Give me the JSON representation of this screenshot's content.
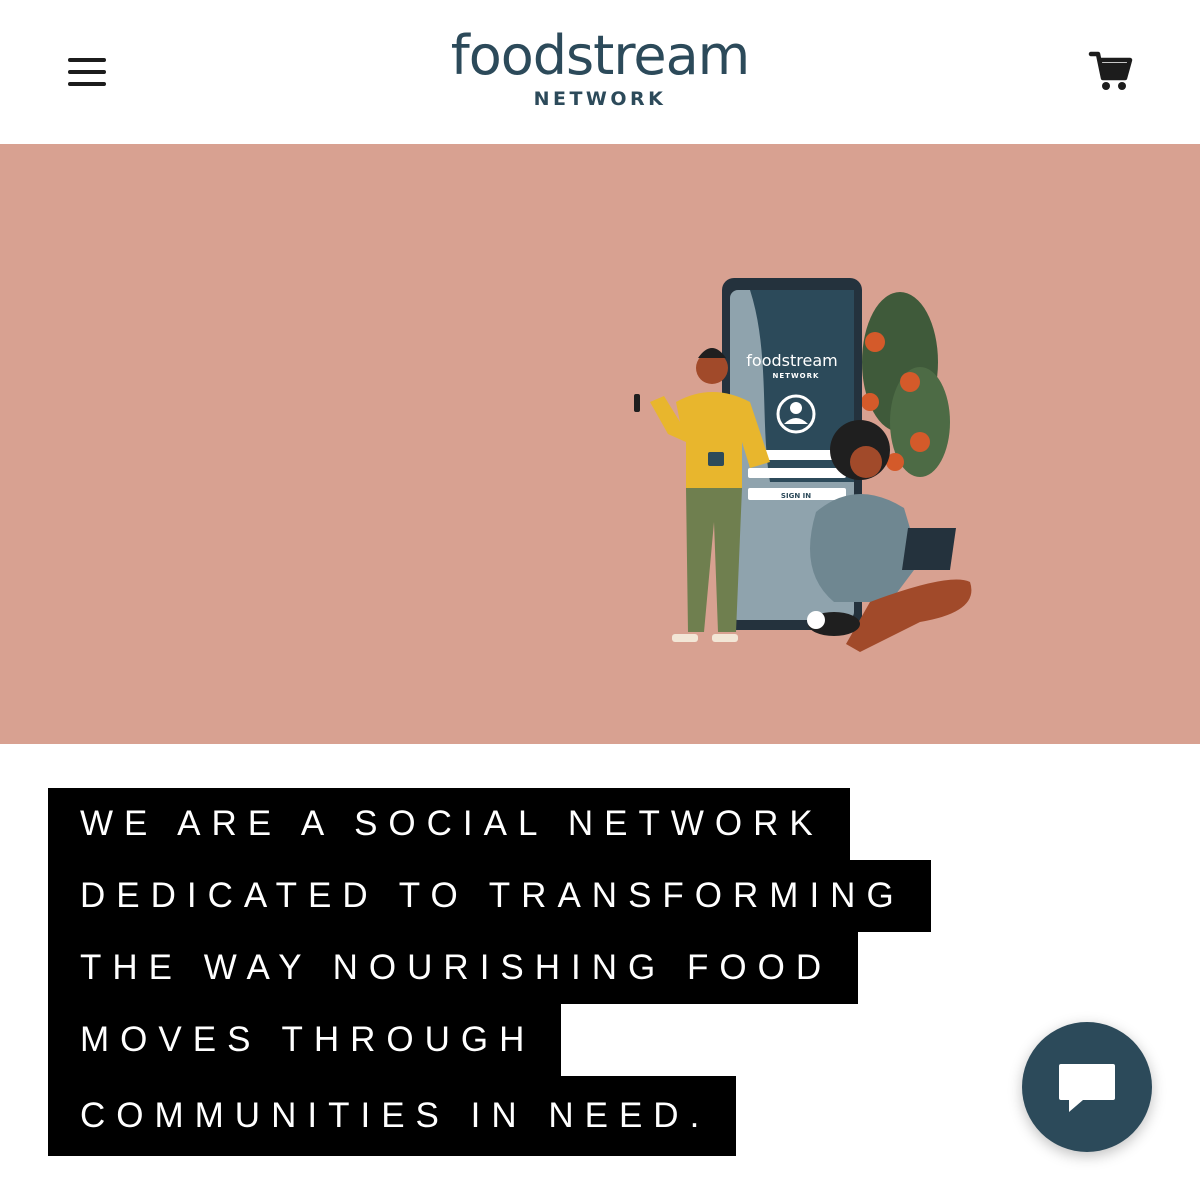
{
  "header": {
    "menu_icon": "hamburger-menu-icon",
    "logo": {
      "word": "foodstream",
      "subtitle": "NETWORK"
    },
    "cart_icon": "shopping-cart-icon"
  },
  "hero": {
    "background_color": "#d8a191",
    "illustration": {
      "device_logo_word": "foodstream",
      "device_logo_subtitle": "NETWORK",
      "sign_in_label": "SIGN IN"
    }
  },
  "mission": {
    "lines": [
      "WE ARE A SOCIAL NETWORK",
      "DEDICATED TO TRANSFORMING",
      "THE WAY NOURISHING FOOD",
      "MOVES THROUGH",
      "COMMUNITIES IN NEED."
    ]
  },
  "chat": {
    "icon": "chat-bubble-icon",
    "color": "#2c4a5a"
  },
  "colors": {
    "brand": "#2c4a5a",
    "hero": "#d8a191",
    "text_block": "#000000"
  }
}
